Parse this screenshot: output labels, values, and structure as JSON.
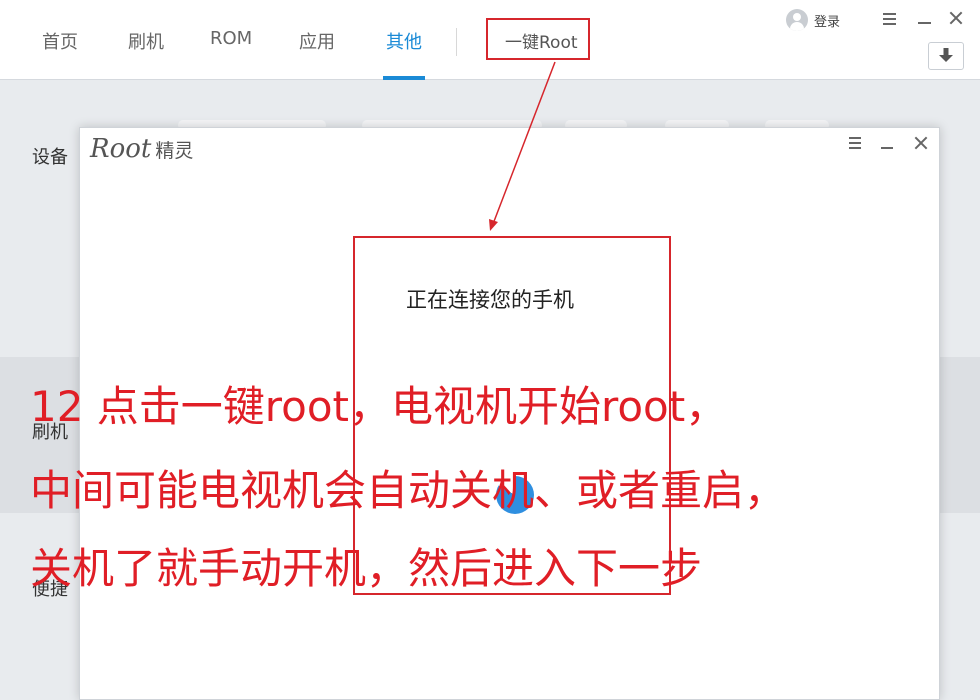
{
  "topbar": {
    "tabs": [
      {
        "label": "首页"
      },
      {
        "label": "刷机"
      },
      {
        "label": "ROM"
      },
      {
        "label": "应用"
      },
      {
        "label": "其他"
      }
    ],
    "active_tab": "其他",
    "root_tab": "一键Root",
    "login": "登录",
    "icons": {
      "avatar": "user-avatar-icon",
      "menu": "menu-icon",
      "minimize": "minimize-icon",
      "close": "close-icon",
      "download": "download-icon"
    }
  },
  "background": {
    "labels": [
      "设备",
      "刷机",
      "便捷"
    ]
  },
  "dialog": {
    "logo_root": "Root",
    "logo_cn": "精灵",
    "status": "正在连接您的手机"
  },
  "annotation": {
    "lines": [
      "12 点击一键root，电视机开始root，",
      "中间可能电视机会自动关机、或者重启，",
      "关机了就手动开机，然后进入下一步"
    ],
    "color": "#e01e26"
  },
  "colors": {
    "accent": "#1a8ad6",
    "annotation_red": "#d6262c",
    "spinner": "#2f8fe0"
  }
}
